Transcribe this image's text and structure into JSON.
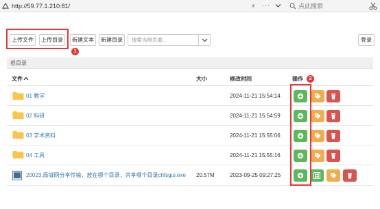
{
  "browser": {
    "url": "http://59.77.1.210:81/",
    "search_placeholder": "点此搜索",
    "icons": [
      "site-icon",
      "bolt-icon",
      "more-icon",
      "chevron-down-icon",
      "search-icon",
      "scissors-icon"
    ]
  },
  "toolbar": {
    "upload_file": "上传文件",
    "upload_dir": "上传目录",
    "new_text": "新建文本",
    "new_dir": "新建目录",
    "search_placeholder": "搜索当前页面...",
    "login": "登录"
  },
  "annotations": {
    "badge1": "1",
    "badge2": "2",
    "highlight_color": "#e33333"
  },
  "breadcrumb": "根目录",
  "table": {
    "headers": {
      "name": "文件",
      "sort_icon": "sort-up-icon",
      "size": "大小",
      "mtime": "修改时间",
      "actions": "操作"
    },
    "rows": [
      {
        "name": "01 教学",
        "size": "",
        "mtime": "2024-11-21 15:54:14",
        "type": "folder"
      },
      {
        "name": "02 科研",
        "size": "",
        "mtime": "2024-11-21 15:54:59",
        "type": "folder"
      },
      {
        "name": "03 学术资料",
        "size": "",
        "mtime": "2024-11-21 15:55:06",
        "type": "folder"
      },
      {
        "name": "04 工具",
        "size": "",
        "mtime": "2024-11-21 15:55:16",
        "type": "folder"
      },
      {
        "name": "20023.局域网分享传输，放在哪个目录，共享哪个目录chfsgui.exe",
        "size": "20.57M",
        "mtime": "2023-09-25 09:27:25",
        "type": "exe"
      }
    ]
  },
  "colors": {
    "link": "#337ab7",
    "download_green": "#5cb85c",
    "rename_orange": "#f0ad4e",
    "delete_red": "#d9534f",
    "folder_yellow": "#f9c54b"
  }
}
